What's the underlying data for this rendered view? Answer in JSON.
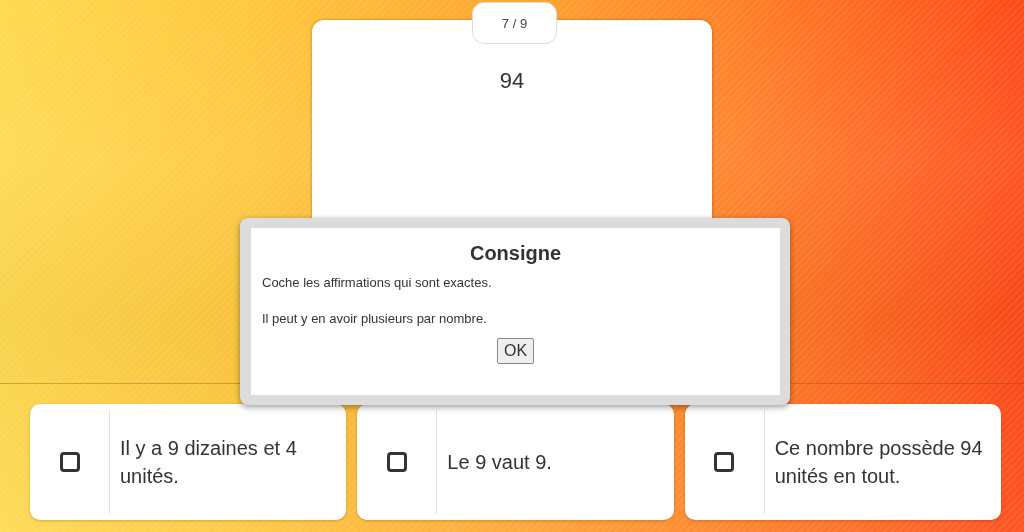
{
  "question": {
    "counter": "7 / 9",
    "prompt": "94"
  },
  "dialog": {
    "title": "Consigne",
    "lines": [
      "Coche les affirmations qui sont exactes.",
      "Il peut y en avoir plusieurs par nombre."
    ],
    "button": "OK"
  },
  "answers": [
    {
      "text": "Il y a 9 dizaines et 4 unités.",
      "checked": false
    },
    {
      "text": "Le 9 vaut 9.",
      "checked": false
    },
    {
      "text": "Ce nombre possède 94 unités en tout.",
      "checked": false
    }
  ]
}
